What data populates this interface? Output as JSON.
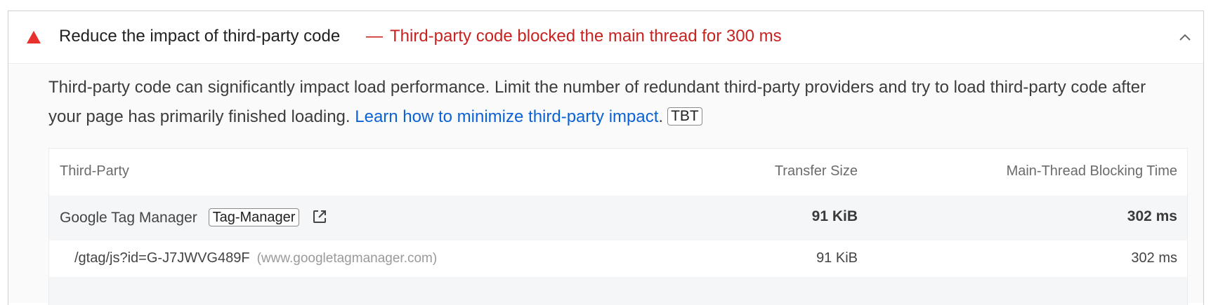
{
  "audit": {
    "title": "Reduce the impact of third-party code",
    "display_value_dash": "—",
    "display_value": "Third-party code blocked the main thread for 300 ms",
    "status_color": "#e8302c",
    "description_text": "Third-party code can significantly impact load performance. Limit the number of redundant third-party providers and try to load third-party code after your page has primarily finished loading.",
    "learn_more_link": "Learn how to minimize third-party impact",
    "description_period": ".",
    "metric_badge": "TBT"
  },
  "table": {
    "columns": {
      "name": "Third-Party",
      "size": "Transfer Size",
      "time": "Main-Thread Blocking Time"
    },
    "entity": {
      "name": "Google Tag Manager",
      "category": "Tag-Manager",
      "transfer_size": "91 KiB",
      "blocking_time": "302 ms"
    },
    "subitem": {
      "url": "/gtag/js?id=G-J7JWVG489F",
      "origin": "(www.googletagmanager.com)",
      "transfer_size": "91 KiB",
      "blocking_time": "302 ms"
    }
  }
}
